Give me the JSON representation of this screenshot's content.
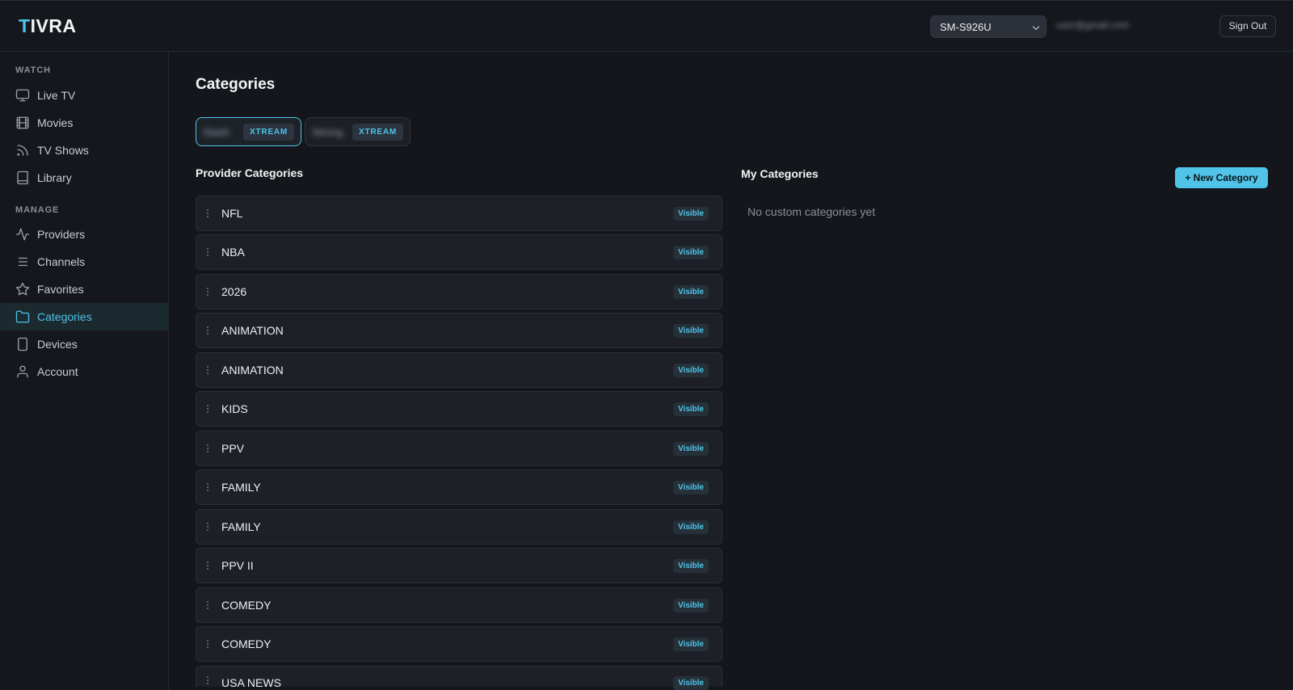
{
  "header": {
    "logo_first": "T",
    "logo_rest": "IVRA",
    "device_selected": "SM-S926U",
    "account_email": "user@gmail.com",
    "sign_out_label": "Sign Out"
  },
  "sidebar": {
    "watch_label": "WATCH",
    "manage_label": "MANAGE",
    "watch_items": [
      {
        "label": "Live TV",
        "icon": "monitor-icon"
      },
      {
        "label": "Movies",
        "icon": "film-icon"
      },
      {
        "label": "TV Shows",
        "icon": "rss-icon"
      },
      {
        "label": "Library",
        "icon": "book-icon"
      }
    ],
    "manage_items": [
      {
        "label": "Providers",
        "icon": "activity-icon"
      },
      {
        "label": "Channels",
        "icon": "list-icon"
      },
      {
        "label": "Favorites",
        "icon": "star-icon"
      },
      {
        "label": "Categories",
        "icon": "folder-icon",
        "active": true
      },
      {
        "label": "Devices",
        "icon": "smartphone-icon"
      },
      {
        "label": "Account",
        "icon": "user-icon"
      }
    ]
  },
  "main": {
    "title": "Categories",
    "providers": [
      {
        "name": "Stash",
        "type": "XTREAM",
        "active": true
      },
      {
        "name": "Strong",
        "type": "XTREAM",
        "active": false
      }
    ],
    "provider_categories_title": "Provider Categories",
    "my_categories_title": "My Categories",
    "new_category_label": "+ New Category",
    "empty_message": "No custom categories yet",
    "visible_label": "Visible",
    "categories": [
      "NFL",
      "NBA",
      "2026",
      "ANIMATION",
      "ANIMATION",
      "KIDS",
      "PPV",
      "FAMILY",
      "FAMILY",
      "PPV II",
      "COMEDY",
      "COMEDY",
      "USA NEWS"
    ]
  },
  "colors": {
    "accent": "#4fc3e8",
    "background": "#14161b",
    "active_nav_bg": "#1b2a2f"
  }
}
